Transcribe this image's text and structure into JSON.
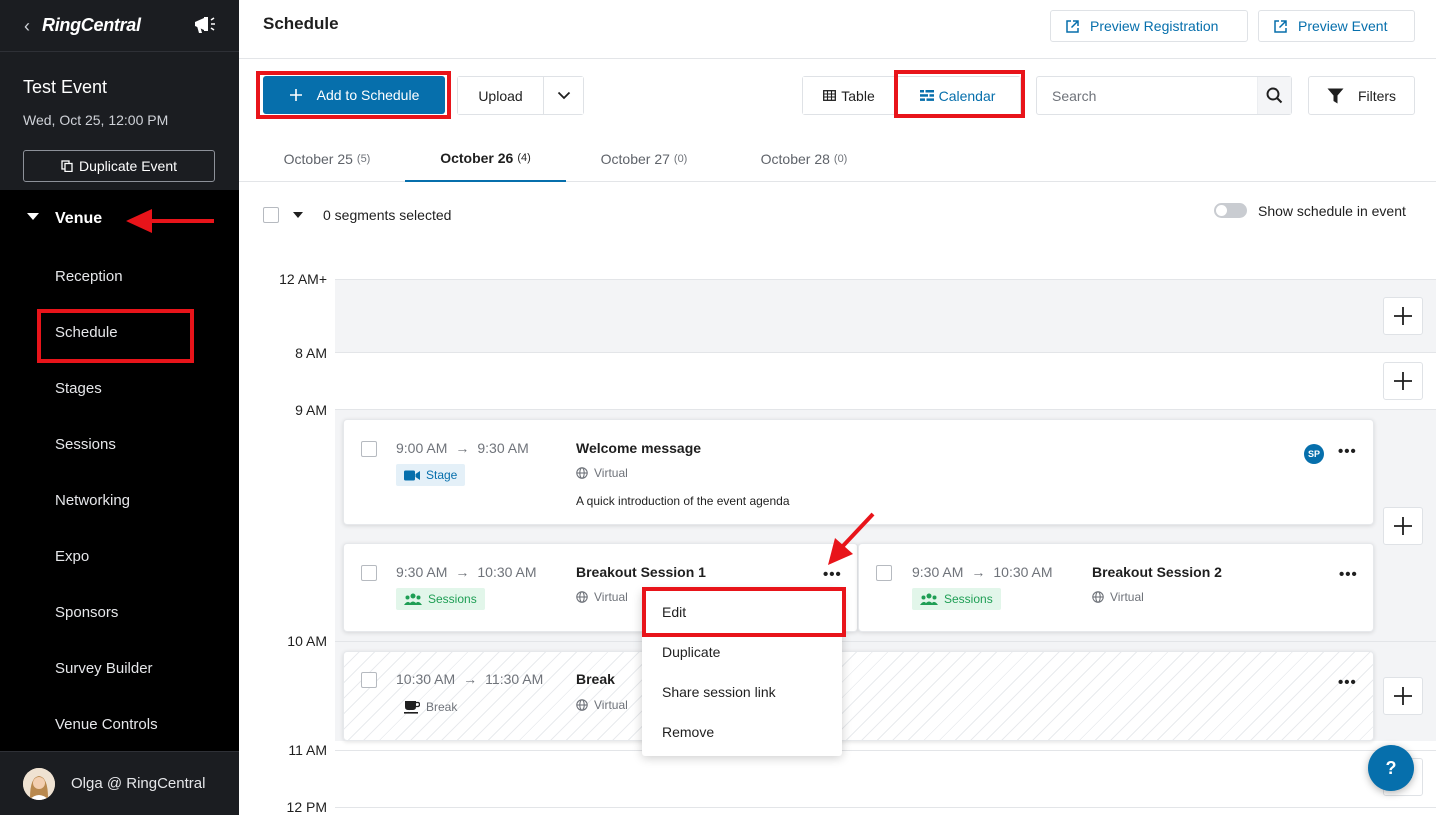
{
  "sidebar": {
    "brand": "RingCentral",
    "event_name": "Test Event",
    "event_date": "Wed, Oct 25, 12:00 PM",
    "duplicate_label": "Duplicate Event",
    "venue_label": "Venue",
    "items": [
      {
        "label": "Reception"
      },
      {
        "label": "Schedule"
      },
      {
        "label": "Stages"
      },
      {
        "label": "Sessions"
      },
      {
        "label": "Networking"
      },
      {
        "label": "Expo"
      },
      {
        "label": "Sponsors"
      },
      {
        "label": "Survey Builder"
      },
      {
        "label": "Venue Controls"
      }
    ],
    "user_name": "Olga @ RingCentral"
  },
  "header": {
    "title": "Schedule",
    "preview_registration": "Preview Registration",
    "preview_event": "Preview Event"
  },
  "toolbar": {
    "add_label": "Add to Schedule",
    "upload_label": "Upload",
    "table_label": "Table",
    "calendar_label": "Calendar",
    "search_placeholder": "Search",
    "filters_label": "Filters"
  },
  "tabs": [
    {
      "label": "October 25",
      "count": "(5)"
    },
    {
      "label": "October 26",
      "count": "(4)",
      "active": true
    },
    {
      "label": "October 27",
      "count": "(0)"
    },
    {
      "label": "October 28",
      "count": "(0)"
    }
  ],
  "selection": {
    "text": "0 segments selected",
    "toggle_label": "Show schedule in event",
    "toggle_on": false
  },
  "time_labels": [
    "12 AM+",
    "8 AM",
    "9 AM",
    "10 AM",
    "11 AM",
    "12 PM"
  ],
  "segments": [
    {
      "start": "9:00 AM",
      "end": "9:30 AM",
      "title": "Welcome message",
      "location": "Virtual",
      "type": "Stage",
      "description": "A quick introduction of the event agenda",
      "badge": "SP"
    },
    {
      "start": "9:30 AM",
      "end": "10:30 AM",
      "title": "Breakout Session 1",
      "location": "Virtual",
      "type": "Sessions"
    },
    {
      "start": "9:30 AM",
      "end": "10:30 AM",
      "title": "Breakout Session 2",
      "location": "Virtual",
      "type": "Sessions"
    },
    {
      "start": "10:30 AM",
      "end": "11:30 AM",
      "title": "Break",
      "location": "Virtual",
      "type": "Break"
    }
  ],
  "arrow_glyph": "→",
  "more_glyph": "•••",
  "context_menu": [
    "Edit",
    "Duplicate",
    "Share session link",
    "Remove"
  ],
  "help_label": "?",
  "colors": {
    "primary": "#066fac",
    "sidebar_bg": "#000000",
    "highlight": "#e8141a",
    "sessions_green": "#1e9e54"
  }
}
